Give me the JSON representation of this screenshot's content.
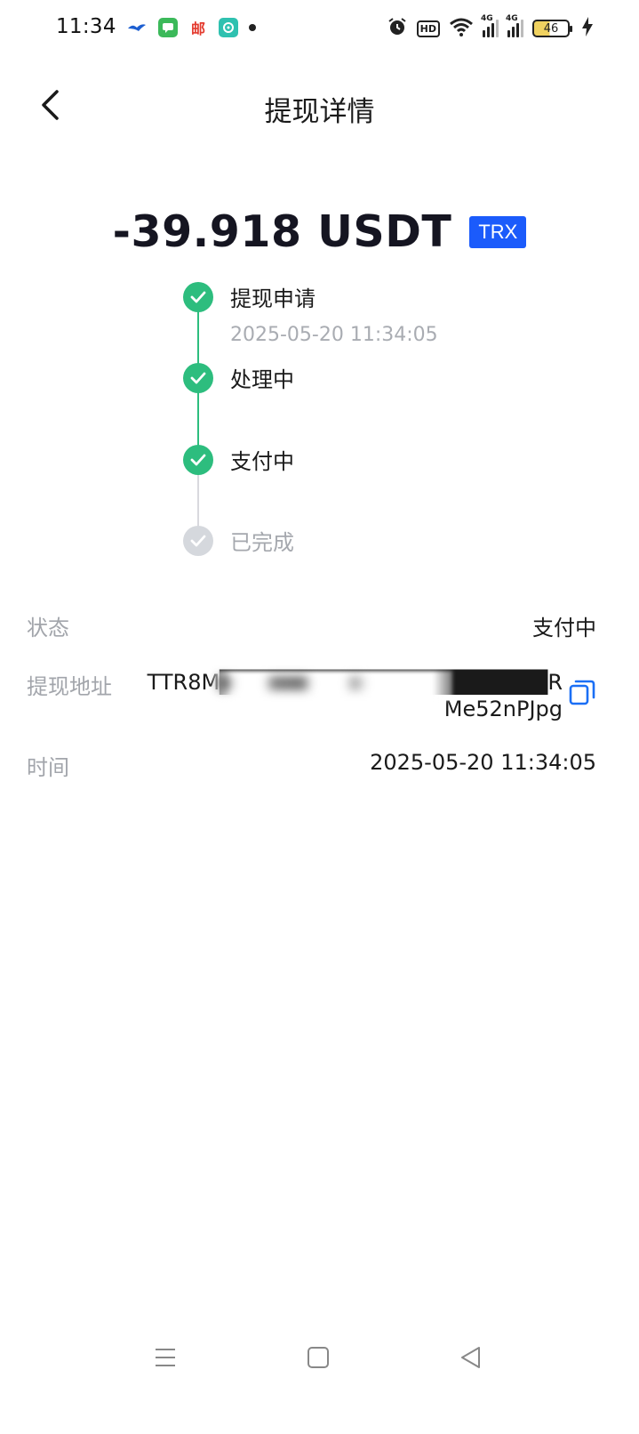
{
  "status_bar": {
    "time": "11:34",
    "left_icons": [
      "bird-app-icon",
      "chat-app-icon",
      "mail-app-icon",
      "soul-app-icon",
      "notification-dot-icon"
    ],
    "right_icons": [
      "alarm-icon",
      "hd-icon",
      "wifi-icon",
      "signal-4g-icon",
      "signal-4g-icon",
      "battery-icon",
      "charging-icon"
    ],
    "hd_label": "HD",
    "signal_label": "4G",
    "battery_level": "46",
    "mail_glyph": "邮"
  },
  "header": {
    "title": "提现详情"
  },
  "amount": {
    "value": "-39.918 USDT",
    "chain_badge": "TRX",
    "badge_color": "#1b5bfb"
  },
  "timeline": {
    "accent_color": "#2dbd7e",
    "steps": [
      {
        "label": "提现申请",
        "time": "2025-05-20 11:34:05",
        "done": true
      },
      {
        "label": "处理中",
        "done": true
      },
      {
        "label": "支付中",
        "done": true
      },
      {
        "label": "已完成",
        "done": false
      }
    ]
  },
  "info": {
    "status_label": "状态",
    "status_value": "支付中",
    "address_label": "提现地址",
    "address_value": "TTR8M████████████████████RMe52nPJpg",
    "time_label": "时间",
    "time_value": "2025-05-20 11:34:05"
  },
  "nav_bar": {
    "icons": [
      "menu-icon",
      "home-icon",
      "back-triangle-icon"
    ]
  }
}
